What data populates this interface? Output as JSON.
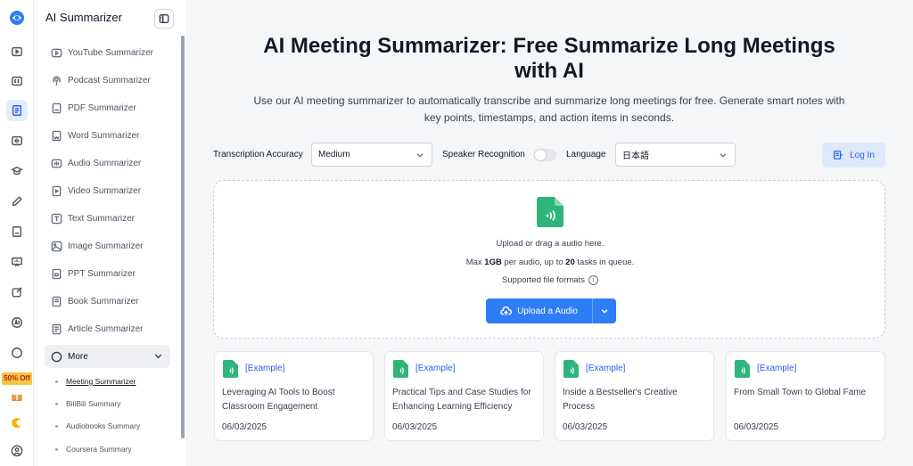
{
  "app": {
    "title": "AI Summarizer",
    "promo_badge": "50% Off",
    "accent_color": "#2f7df6",
    "file_icon_color": "#2fb57a"
  },
  "rail": {
    "icons": [
      "logo-icon",
      "youtube-icon",
      "cc-icon",
      "document-icon",
      "audio-wave-icon",
      "graduation-icon",
      "pen-icon",
      "pdf-icon",
      "presentation-icon",
      "edit-icon",
      "ai-icon",
      "circle-icon",
      "gift-icon",
      "moon-icon",
      "user-icon"
    ]
  },
  "sidebar": {
    "items": [
      {
        "label": "YouTube Summarizer",
        "icon": "youtube-icon"
      },
      {
        "label": "Podcast Summarizer",
        "icon": "podcast-icon"
      },
      {
        "label": "PDF Summarizer",
        "icon": "pdf-icon"
      },
      {
        "label": "Word Summarizer",
        "icon": "word-icon"
      },
      {
        "label": "Audio Summarizer",
        "icon": "audio-icon"
      },
      {
        "label": "Video Summarizer",
        "icon": "video-icon"
      },
      {
        "label": "Text Summarizer",
        "icon": "text-icon"
      },
      {
        "label": "Image Summarizer",
        "icon": "image-icon"
      },
      {
        "label": "PPT Summarizer",
        "icon": "ppt-icon"
      },
      {
        "label": "Book Summarizer",
        "icon": "book-icon"
      },
      {
        "label": "Article Summarizer",
        "icon": "article-icon"
      }
    ],
    "more_label": "More",
    "sub_items": [
      "Meeting Summarizer",
      "BiliBili Summary",
      "Audiobooks Summary",
      "Coursera Summary"
    ]
  },
  "main": {
    "title_line1": "AI Meeting Summarizer: Free Summarize Long Meetings",
    "title_line2": "with AI",
    "subtitle_line1": "Use our AI meeting summarizer to automatically transcribe and summarize long meetings for free. Generate smart notes with",
    "subtitle_line2": "key points, timestamps, and action items in seconds.",
    "options": {
      "accuracy_label": "Transcription Accuracy",
      "accuracy_value": "Medium",
      "speaker_label": "Speaker Recognition",
      "speaker_enabled": false,
      "language_label": "Language",
      "language_value": "日本語"
    },
    "login_label": "Log In",
    "upload": {
      "prompt": "Upload or drag a audio here.",
      "limit_prefix": "Max ",
      "limit_size": "1GB",
      "limit_middle": " per audio, up to ",
      "limit_tasks": "20",
      "limit_suffix": " tasks in queue.",
      "formats_label": "Supported file formats",
      "button_label": "Upload a Audio"
    },
    "examples": [
      {
        "tag": "[Example]",
        "title": "Leveraging AI Tools to Boost Classroom Engagement",
        "date": "06/03/2025"
      },
      {
        "tag": "[Example]",
        "title": "Practical Tips and Case Studies for Enhancing Learning Efficiency",
        "date": "06/03/2025"
      },
      {
        "tag": "[Example]",
        "title": "Inside a Bestseller's Creative Process",
        "date": "06/03/2025"
      },
      {
        "tag": "[Example]",
        "title": "From Small Town to Global Fame",
        "date": "06/03/2025"
      }
    ]
  }
}
